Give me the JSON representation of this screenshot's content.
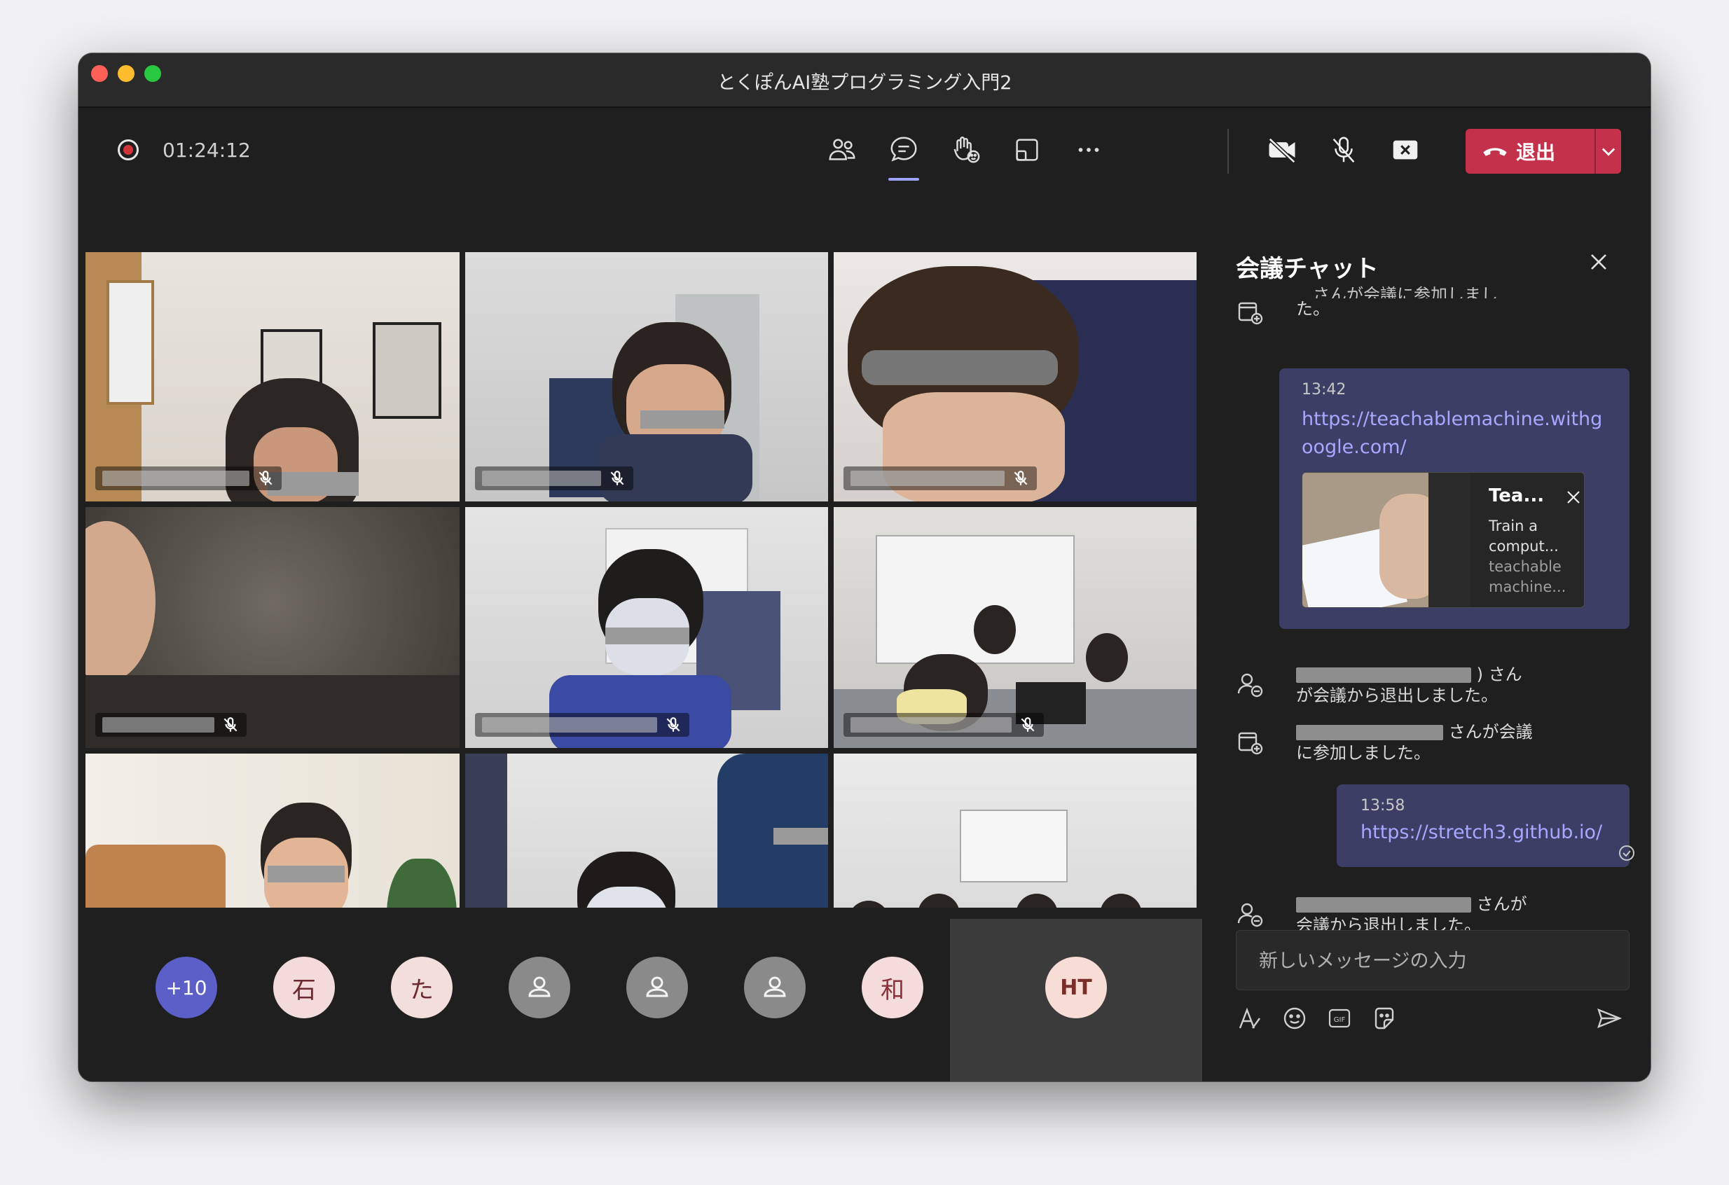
{
  "window": {
    "title": "とくぽんAI塾プログラミング入門2"
  },
  "toolbar": {
    "timer": "01:24:12",
    "leave_label": "退出",
    "icons": [
      "people-icon",
      "chat-icon",
      "raise-hand-icon",
      "share-tray-icon",
      "more-icon",
      "camera-off-icon",
      "mic-off-icon",
      "share-stop-icon"
    ],
    "accent": "#c4314b"
  },
  "roster": {
    "overflow_label": "+10",
    "avatars": [
      {
        "initial": "石",
        "color": "#f3dadb",
        "text_color": "#6b2a2f"
      },
      {
        "initial": "た",
        "color": "#f2dfdc",
        "text_color": "#6b2a2f"
      },
      {
        "initial": "",
        "icon": "person-icon",
        "color": "#8a8a8a"
      },
      {
        "initial": "",
        "icon": "person-icon",
        "color": "#8a8a8a"
      },
      {
        "initial": "",
        "icon": "person-icon",
        "color": "#8a8a8a"
      },
      {
        "initial": "和",
        "color": "#f4dcdc",
        "text_color": "#8b2f3a"
      }
    ],
    "active_initials": "HT"
  },
  "chat": {
    "title": "会議チャット",
    "messages": [
      {
        "type": "system",
        "text_top": "…さんが会議に参加しまし",
        "text_bottom": "た。"
      },
      {
        "type": "bubble",
        "time": "13:42",
        "link": "https://teachablemachine.withgoogle.com/",
        "preview": {
          "title": "Tea...",
          "desc": "Train a comput...",
          "site": "teachable machine..."
        }
      },
      {
        "type": "system",
        "suffix_1": ") さん",
        "line_2": "が会議から退出しました。"
      },
      {
        "type": "system",
        "suffix_1": "さんが会議",
        "line_2": "に参加しました。"
      },
      {
        "type": "bubble",
        "time": "13:58",
        "link": "https://stretch3.github.io/"
      },
      {
        "type": "system",
        "suffix_1": "さんが",
        "line_2": "会議から退出しました。"
      }
    ],
    "compose_placeholder": "新しいメッセージの入力"
  }
}
